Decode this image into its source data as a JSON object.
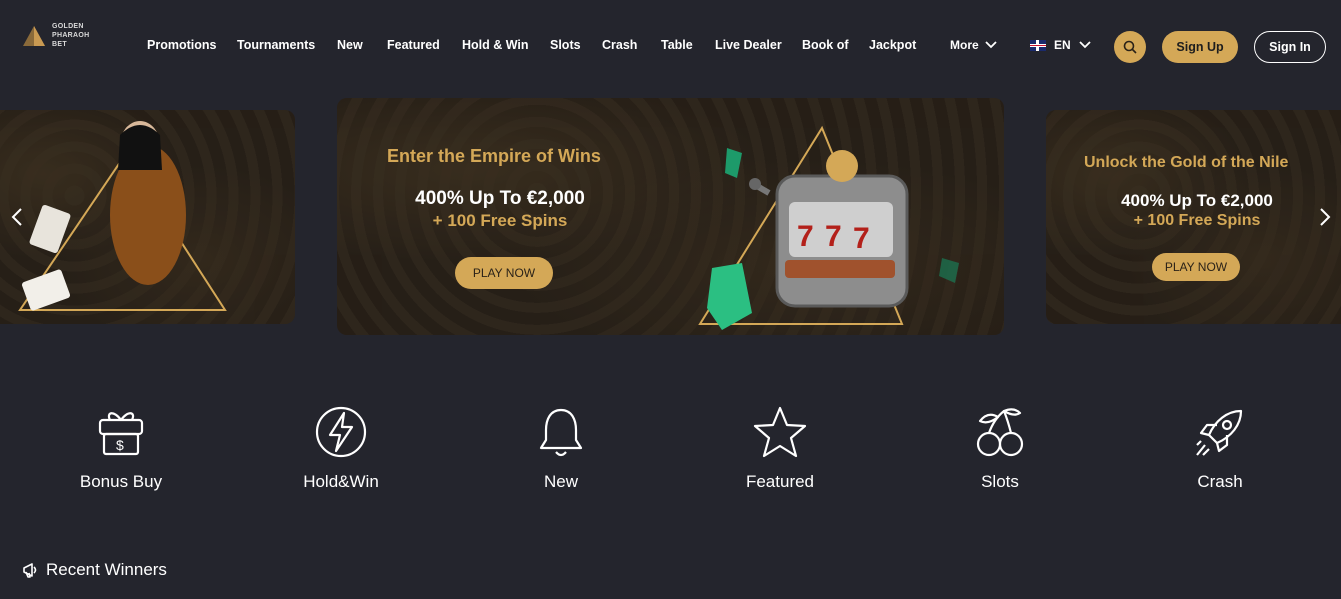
{
  "brand": {
    "logo_lines": [
      "GOLDEN",
      "PHARAOH",
      "BET"
    ]
  },
  "nav": {
    "items": [
      "Promotions",
      "Tournaments",
      "New",
      "Featured",
      "Hold & Win",
      "Slots",
      "Crash",
      "Table",
      "Live Dealer",
      "Book of",
      "Jackpot"
    ],
    "more_label": "More",
    "language": "EN"
  },
  "auth": {
    "signup_label": "Sign Up",
    "signin_label": "Sign In"
  },
  "banners": {
    "main": {
      "title": "Enter the Empire of Wins",
      "offer": "400% Up To €2,000",
      "spins": "+ 100 Free Spins",
      "cta": "PLAY NOW"
    },
    "right": {
      "title": "Unlock the Gold of the Nile",
      "offer": "400% Up To €2,000",
      "spins": "+ 100 Free Spins",
      "cta": "PLAY NOW"
    }
  },
  "categories": [
    "Bonus Buy",
    "Hold&Win",
    "New",
    "Featured",
    "Slots",
    "Crash"
  ],
  "recent_winners_label": "Recent Winners",
  "colors": {
    "background": "#24252d",
    "accent_gold": "#d4a857",
    "banner_bg": "#2b231a"
  },
  "icons": [
    "logo-pyramid-icon",
    "chevron-down-icon",
    "uk-flag-icon",
    "search-icon",
    "chevron-left-icon",
    "chevron-right-icon",
    "gift-icon",
    "lightning-icon",
    "bell-icon",
    "star-icon",
    "cherries-icon",
    "rocket-icon",
    "megaphone-icon"
  ]
}
